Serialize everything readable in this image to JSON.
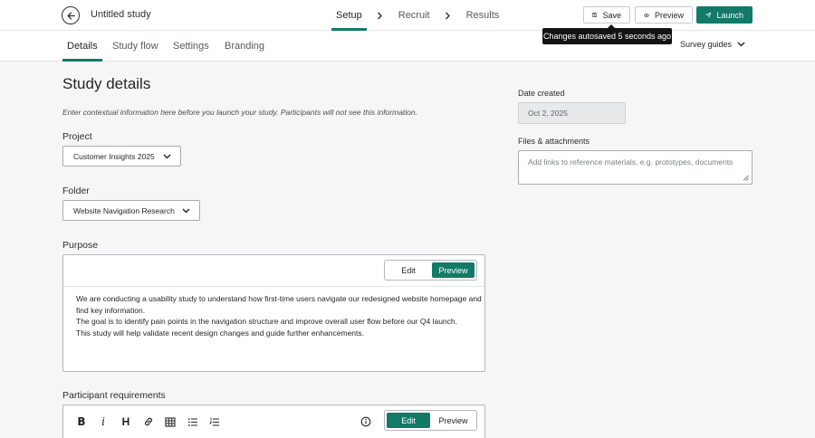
{
  "header": {
    "title": "Untitled study",
    "steps": [
      {
        "label": "Setup",
        "active": true
      },
      {
        "label": "Recruit",
        "active": false
      },
      {
        "label": "Results",
        "active": false
      }
    ],
    "save_label": "Save",
    "preview_label": "Preview",
    "launch_label": "Launch",
    "tooltip": "Changes autosaved 5 seconds ago"
  },
  "tabs": [
    {
      "label": "Details",
      "active": true
    },
    {
      "label": "Study flow",
      "active": false
    },
    {
      "label": "Settings",
      "active": false
    },
    {
      "label": "Branding",
      "active": false
    }
  ],
  "survey_guides_label": "Survey guides",
  "main": {
    "heading": "Study details",
    "intro": "Enter contextual information here before you launch your study. Participants will not see this information.",
    "project_label": "Project",
    "project_value": "Customer Insights 2025",
    "folder_label": "Folder",
    "folder_value": "Website Navigation Research",
    "purpose_label": "Purpose",
    "purpose_edit": "Edit",
    "purpose_preview": "Preview",
    "purpose_lines": [
      "We are conducting a usability study to understand how first-time users navigate our redesigned website homepage and find key information.",
      "The goal is to identify pain points in the navigation structure and improve overall user flow before our Q4 launch.",
      "This study will help validate recent design changes and guide further enhancements."
    ],
    "participant_label": "Participant requirements",
    "participant_edit": "Edit",
    "participant_preview": "Preview"
  },
  "side": {
    "date_label": "Date created",
    "date_value": "Oct 2, 2025",
    "files_label": "Files & attachments",
    "files_placeholder": "Add links to reference materials, e.g. prototypes, documents"
  },
  "colors": {
    "accent": "#127a67",
    "tooltip_bg": "#111315",
    "page_bg": "#f6f6f7"
  },
  "icons": [
    "arrow-left-icon",
    "chevron-right-icon",
    "save-icon",
    "eye-icon",
    "send-icon",
    "chevron-down-icon",
    "bold-icon",
    "italic-icon",
    "heading-icon",
    "link-icon",
    "table-icon",
    "bullet-list-icon",
    "numbered-list-icon",
    "info-icon"
  ]
}
